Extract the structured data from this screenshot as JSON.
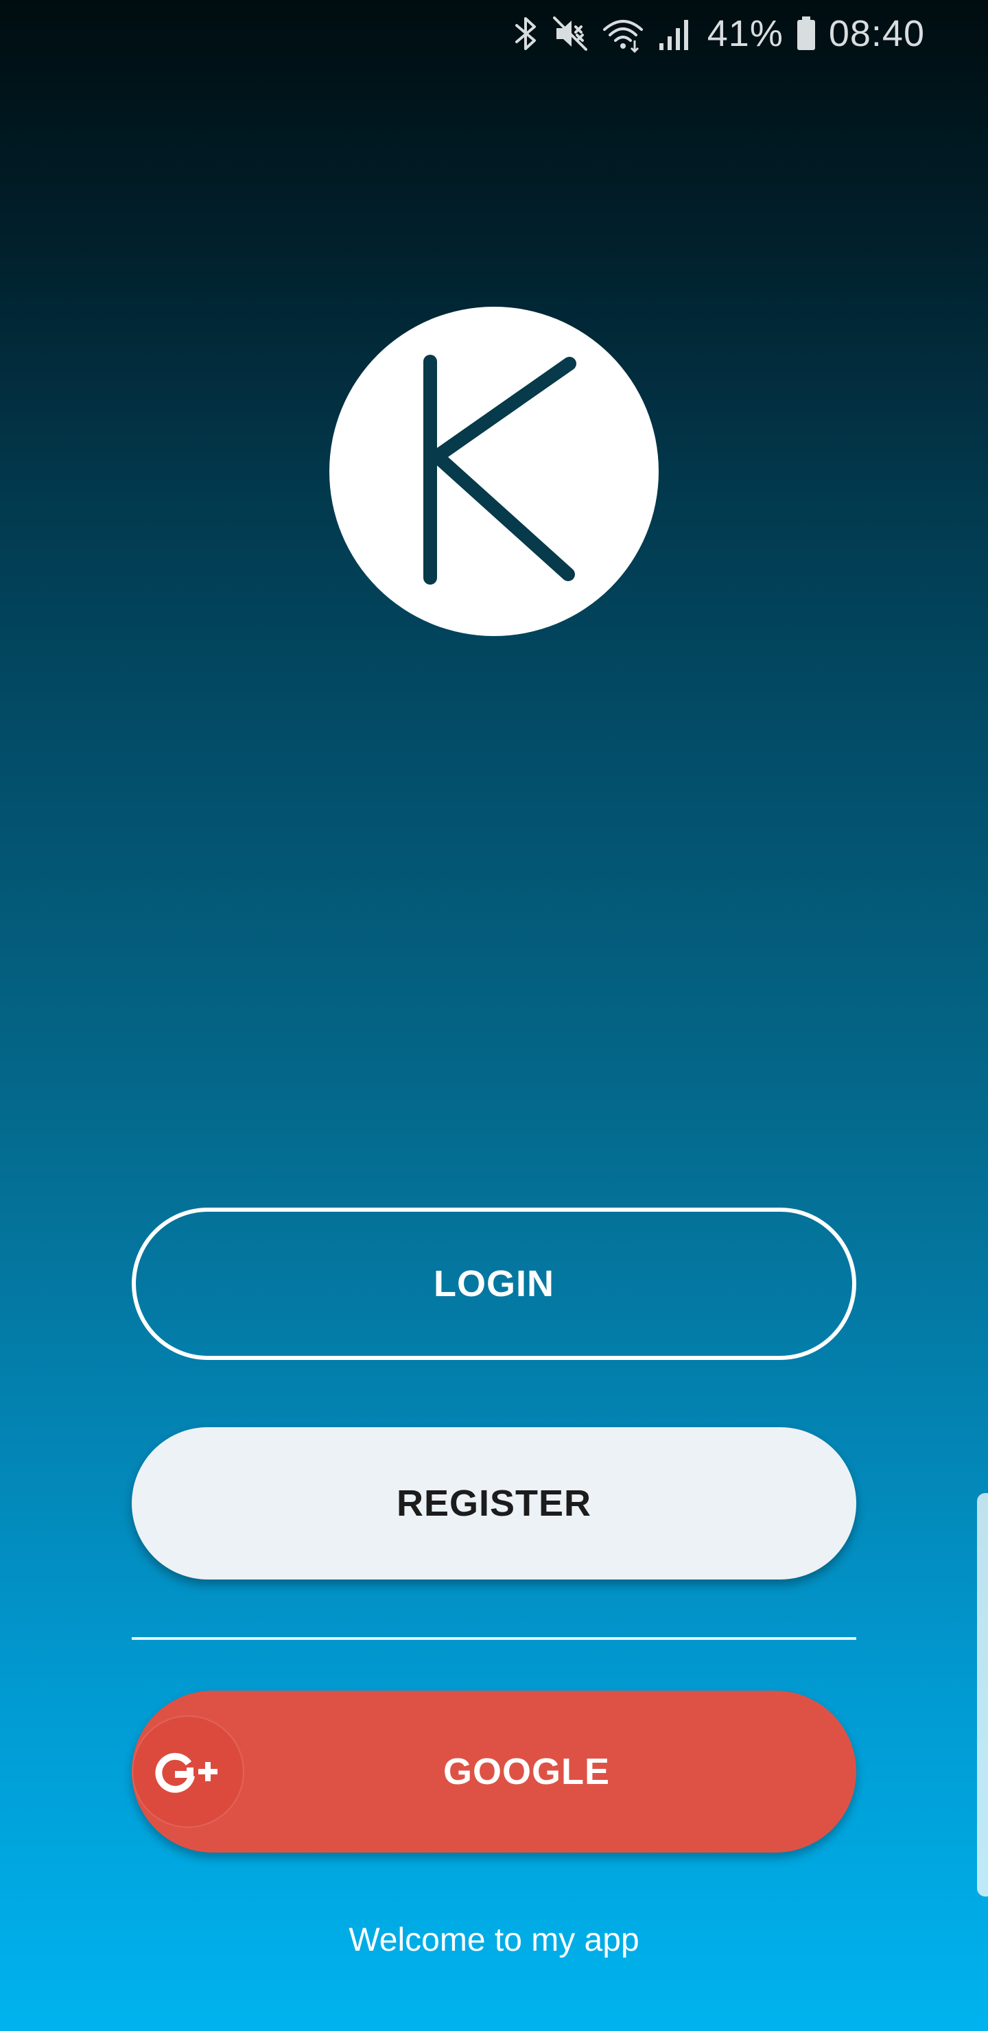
{
  "status_bar": {
    "icons": [
      "bluetooth-icon",
      "vibrate-mute-icon",
      "wifi-icon",
      "cellular-signal-icon",
      "battery-icon"
    ],
    "battery_percent": "41%",
    "time": "08:40"
  },
  "logo": {
    "letter": "K",
    "icon": "k-logo-icon"
  },
  "buttons": {
    "login": "LOGIN",
    "register": "REGISTER",
    "google": "GOOGLE"
  },
  "google_icon": "google-plus-icon",
  "welcome_text": "Welcome to my app",
  "colors": {
    "gradient_top": "#000d10",
    "gradient_bottom": "#00b3ee",
    "logo_letter": "#073a4a",
    "register_bg": "#ecf2f5",
    "google_red": "#de5246"
  }
}
